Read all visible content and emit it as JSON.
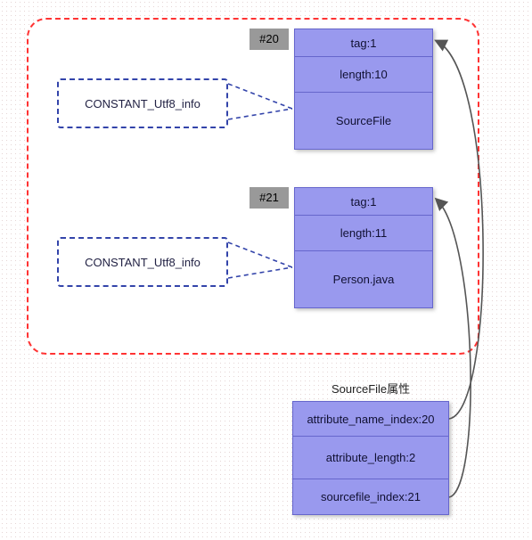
{
  "group": {
    "entries": [
      {
        "badge": "#20",
        "callout_label": "CONSTANT_Utf8_info",
        "cells": [
          "tag:1",
          "length:10",
          "SourceFile"
        ]
      },
      {
        "badge": "#21",
        "callout_label": "CONSTANT_Utf8_info",
        "cells": [
          "tag:1",
          "length:11",
          "Person.java"
        ]
      }
    ]
  },
  "attribute_block": {
    "title": "SourceFile属性",
    "cells": [
      "attribute_name_index:20",
      "attribute_length:2",
      "sourcefile_index:21"
    ]
  },
  "colors": {
    "cell_bg": "#9999ee",
    "cell_border": "#6666cc",
    "badge_bg": "#999999",
    "red_border": "#ff3333",
    "callout_border": "#3344aa"
  }
}
